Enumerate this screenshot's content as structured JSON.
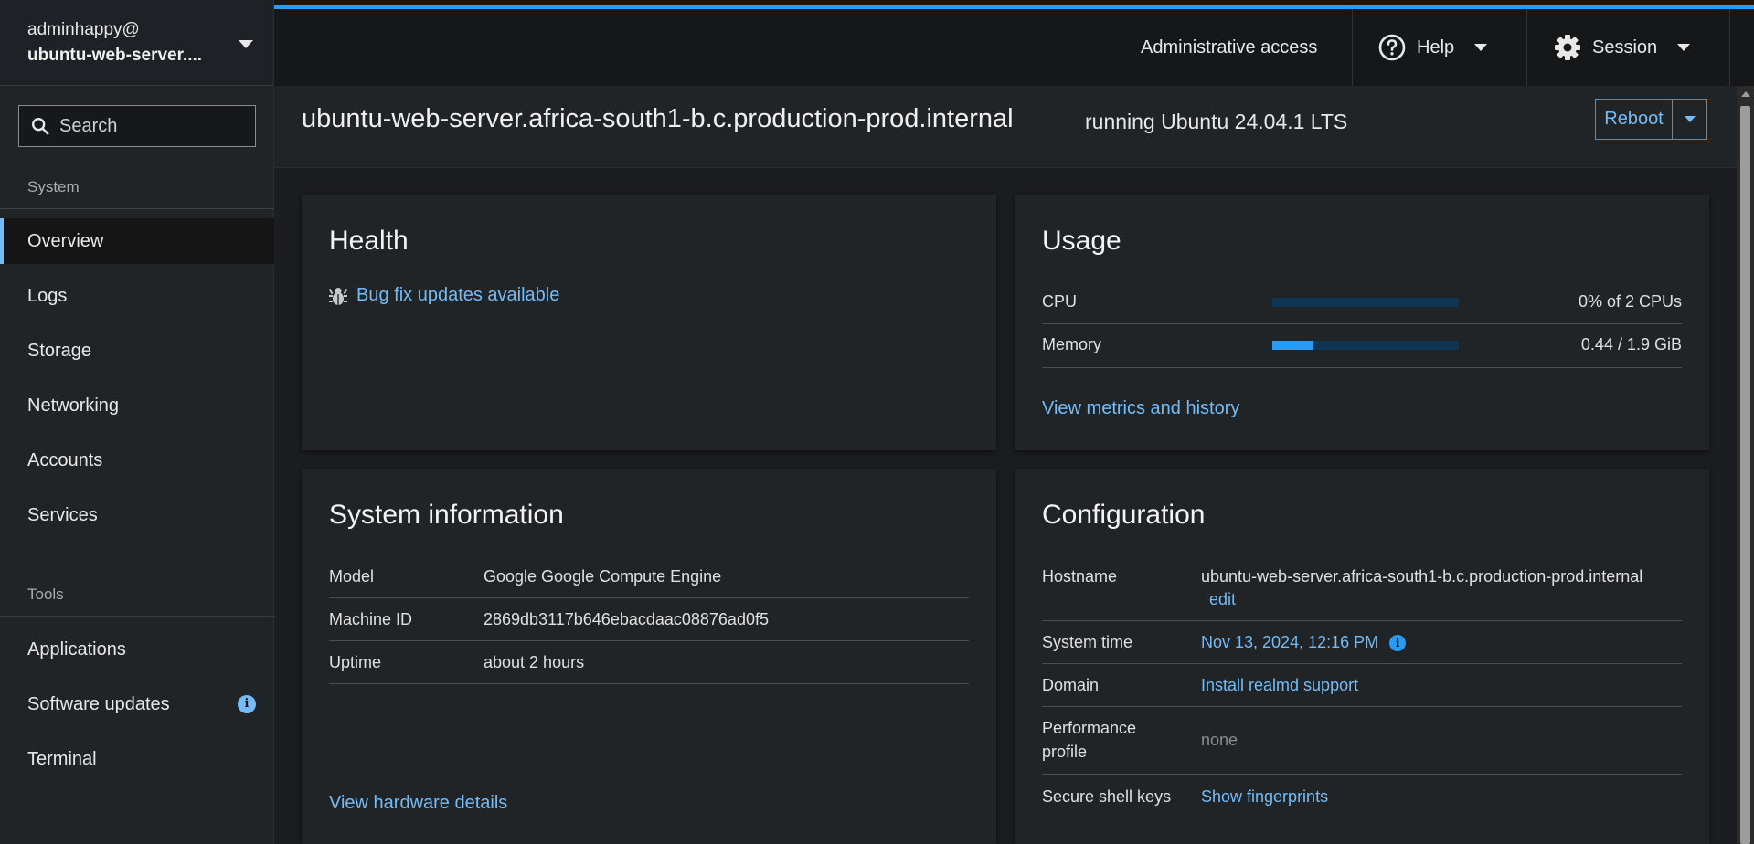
{
  "host": {
    "user": "adminhappy@",
    "name": "ubuntu-web-server...."
  },
  "search": {
    "placeholder": "Search"
  },
  "sidebar": {
    "system_title": "System",
    "system_items": [
      "Overview",
      "Logs",
      "Storage",
      "Networking",
      "Accounts",
      "Services"
    ],
    "tools_title": "Tools",
    "tools_items": [
      "Applications",
      "Software updates",
      "Terminal"
    ],
    "active": "Overview",
    "software_updates_badge": "i"
  },
  "topbar": {
    "admin_access": "Administrative access",
    "help": "Help",
    "session": "Session"
  },
  "header": {
    "title": "ubuntu-web-server.africa-south1-b.c.production-prod.internal",
    "subtitle": "running Ubuntu 24.04.1 LTS",
    "reboot": "Reboot"
  },
  "health": {
    "title": "Health",
    "updates_link": "Bug fix updates available"
  },
  "usage": {
    "title": "Usage",
    "cpu_label": "CPU",
    "cpu_value": "0% of 2 CPUs",
    "cpu_fraction": 0.0,
    "memory_label": "Memory",
    "memory_value": "0.44 / 1.9 GiB",
    "memory_fraction": 0.22,
    "metrics_link": "View metrics and history"
  },
  "system_info": {
    "title": "System information",
    "rows": [
      {
        "label": "Model",
        "value": "Google Google Compute Engine"
      },
      {
        "label": "Machine ID",
        "value": "2869db3117b646ebacdaac08876ad0f5"
      },
      {
        "label": "Uptime",
        "value": "about 2 hours"
      }
    ],
    "hardware_link": "View hardware details"
  },
  "configuration": {
    "title": "Configuration",
    "hostname_label": "Hostname",
    "hostname_value": "ubuntu-web-server.africa-south1-b.c.production-prod.internal",
    "hostname_edit": "edit",
    "time_label": "System time",
    "time_value": "Nov 13, 2024, 12:16 PM",
    "domain_label": "Domain",
    "domain_value": "Install realmd support",
    "perf_label_1": "Performance",
    "perf_label_2": "profile",
    "perf_value": "none",
    "ssh_label": "Secure shell keys",
    "ssh_value": "Show fingerprints"
  },
  "colors": {
    "accent": "#2b9af3",
    "link": "#73bcf7",
    "background": "#1b1d21",
    "card": "#212427"
  }
}
